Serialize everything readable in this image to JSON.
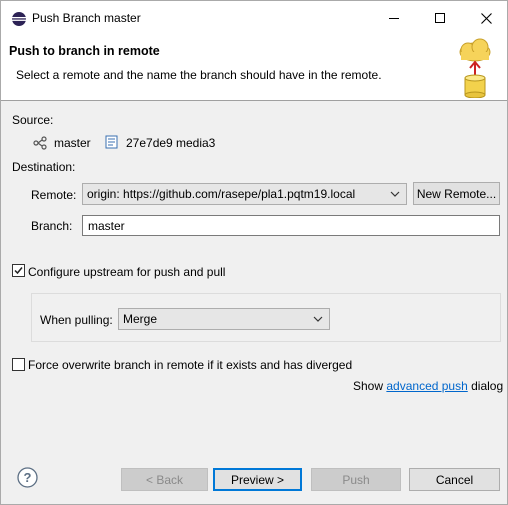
{
  "window": {
    "title": "Push Branch master"
  },
  "banner": {
    "title": "Push to branch in remote",
    "message": "Select a remote and the name the branch should have in the remote."
  },
  "source": {
    "label": "Source:",
    "branch": "master",
    "commit_id": "27e7de9",
    "commit_message": "media3"
  },
  "destination": {
    "label": "Destination:",
    "remote_label": "Remote:",
    "remote_value": "origin: https://github.com/rasepe/pla1.pqtm19.local",
    "new_remote_button": "New Remote...",
    "branch_label": "Branch:",
    "branch_value": "master"
  },
  "upstream": {
    "label": "Configure upstream for push and pull",
    "checked": true,
    "when_pulling_label": "When pulling:",
    "when_pulling_value": "Merge"
  },
  "force": {
    "label": "Force overwrite branch in remote if it exists and has diverged",
    "checked": false
  },
  "advanced": {
    "prefix": "Show",
    "link": "advanced push",
    "suffix": "dialog"
  },
  "buttons": {
    "back": "< Back",
    "preview": "Preview >",
    "push": "Push",
    "cancel": "Cancel"
  },
  "icons": {
    "app": "eclipse-icon",
    "banner": "push-to-cloud-icon",
    "branch": "branch-icon",
    "commit": "commit-icon",
    "help": "help-icon"
  }
}
